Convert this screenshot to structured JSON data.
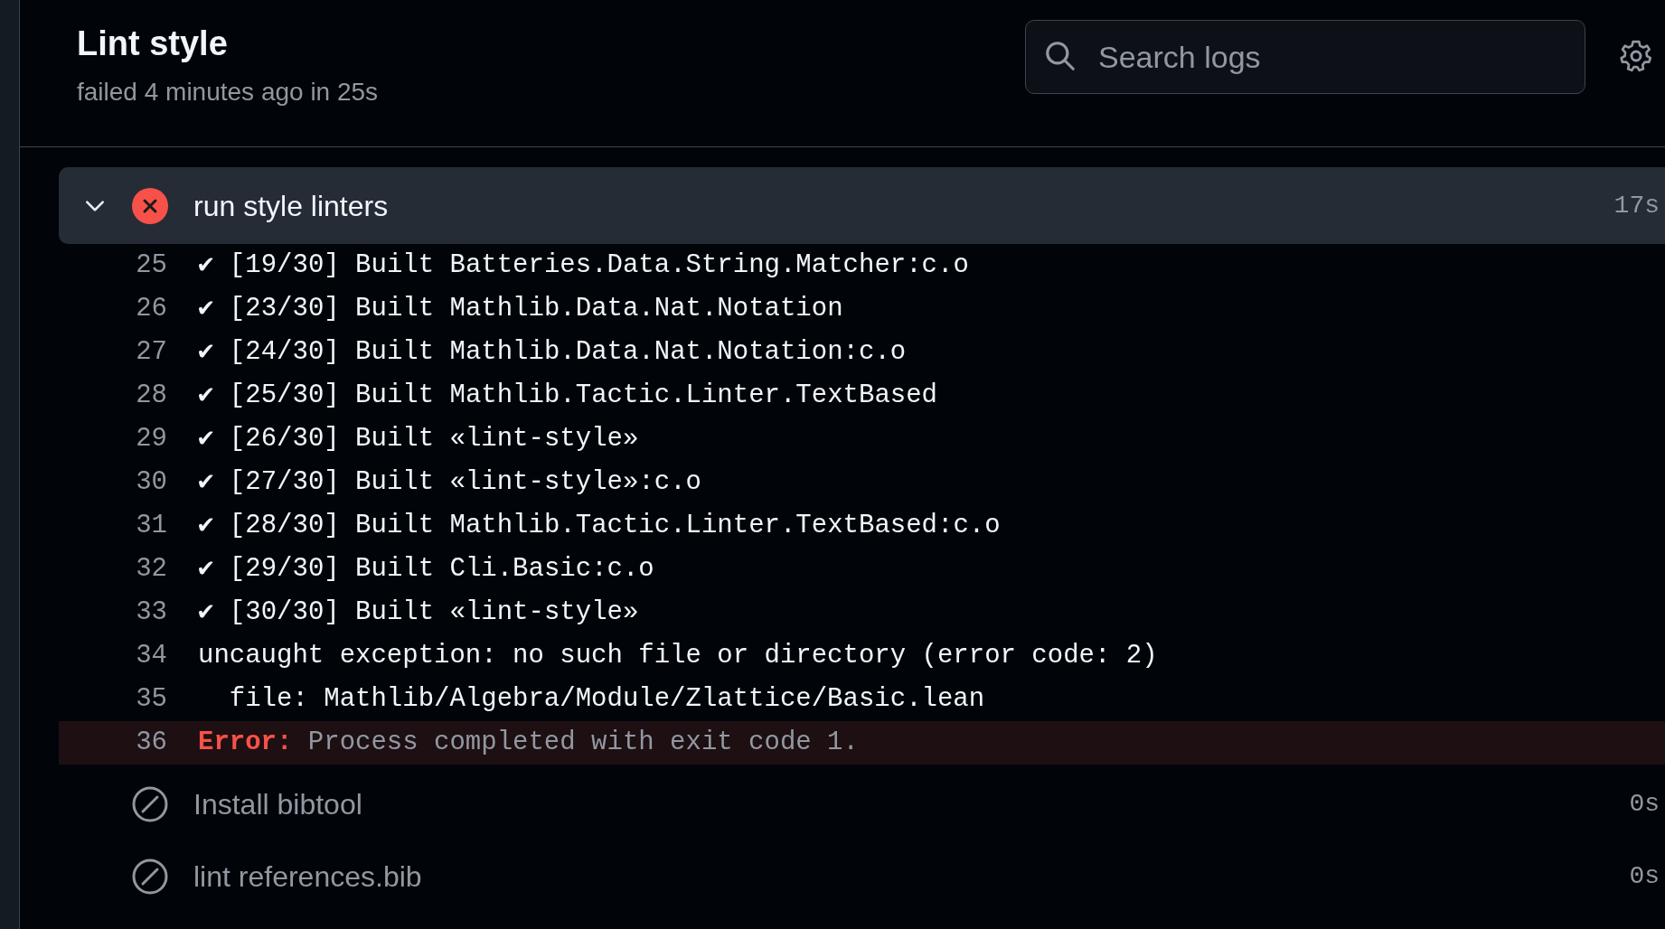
{
  "job": {
    "title": "Lint style",
    "subtitle": "failed 4 minutes ago in 25s"
  },
  "search": {
    "placeholder": "Search logs"
  },
  "steps": [
    {
      "name": "run style linters",
      "kind": "failed",
      "duration": "17s",
      "expanded": true,
      "lines": [
        {
          "number": "25",
          "text": "✔ [19/30] Built Batteries.Data.String.Matcher:c.o",
          "kind": "normal"
        },
        {
          "number": "26",
          "text": "✔ [23/30] Built Mathlib.Data.Nat.Notation",
          "kind": "normal"
        },
        {
          "number": "27",
          "text": "✔ [24/30] Built Mathlib.Data.Nat.Notation:c.o",
          "kind": "normal"
        },
        {
          "number": "28",
          "text": "✔ [25/30] Built Mathlib.Tactic.Linter.TextBased",
          "kind": "normal"
        },
        {
          "number": "29",
          "text": "✔ [26/30] Built «lint-style»",
          "kind": "normal"
        },
        {
          "number": "30",
          "text": "✔ [27/30] Built «lint-style»:c.o",
          "kind": "normal"
        },
        {
          "number": "31",
          "text": "✔ [28/30] Built Mathlib.Tactic.Linter.TextBased:c.o",
          "kind": "normal"
        },
        {
          "number": "32",
          "text": "✔ [29/30] Built Cli.Basic:c.o",
          "kind": "normal"
        },
        {
          "number": "33",
          "text": "✔ [30/30] Built «lint-style»",
          "kind": "normal"
        },
        {
          "number": "34",
          "text": "uncaught exception: no such file or directory (error code: 2)",
          "kind": "normal"
        },
        {
          "number": "35",
          "text": "  file: Mathlib/Algebra/Module/Zlattice/Basic.lean",
          "kind": "normal"
        },
        {
          "number": "36",
          "prefix": "Error:",
          "text": "Process completed with exit code 1.",
          "kind": "error"
        }
      ]
    },
    {
      "name": "Install bibtool",
      "kind": "skipped",
      "duration": "0s",
      "expanded": false
    },
    {
      "name": "lint references.bib",
      "kind": "skipped",
      "duration": "0s",
      "expanded": false
    }
  ]
}
